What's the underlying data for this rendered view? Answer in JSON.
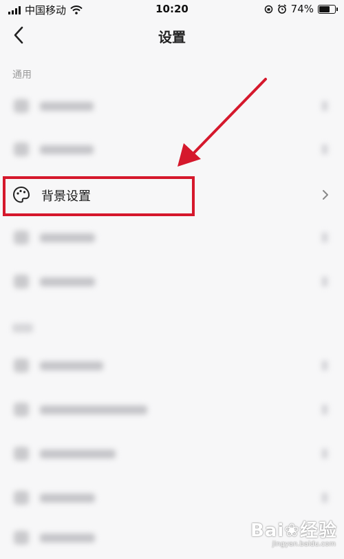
{
  "status_bar": {
    "carrier": "中国移动",
    "time": "10:20",
    "battery": "74%",
    "battery_level": 0.74
  },
  "nav": {
    "title": "设置",
    "back_icon": "chevron-left-icon"
  },
  "sections": [
    {
      "title": "通用"
    },
    {
      "title": ""
    }
  ],
  "highlighted_item": {
    "label": "背景设置",
    "icon": "palette-icon",
    "chevron_icon": "chevron-right-icon"
  },
  "annotation": {
    "color": "#d5182c"
  },
  "watermark": {
    "main": "Bai❀经验",
    "sub": "jingyan.baidu.com"
  }
}
